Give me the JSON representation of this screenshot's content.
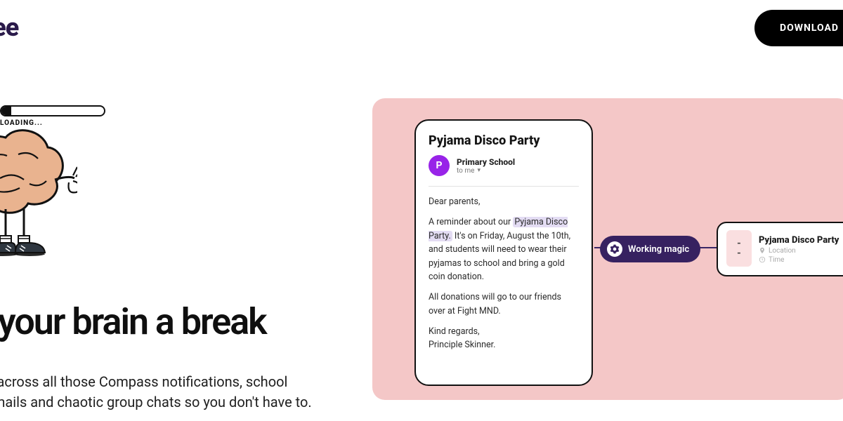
{
  "header": {
    "logo": "dee",
    "download": "DOWNLOAD"
  },
  "hero": {
    "loading_label": "LOADING...",
    "headline": "e your brain a break",
    "subtext_line1": "ays across all those Compass notifications, school",
    "subtext_line2": "s, emails and chaotic group chats so you don't have to."
  },
  "email": {
    "title": "Pyjama Disco Party",
    "avatar_letter": "P",
    "from_name": "Primary School",
    "to_line": "to me",
    "greeting": "Dear parents,",
    "body_pre": "A reminder about our ",
    "body_highlight": "Pyjama Disco Party.",
    "body_post": " It's on Friday, August the 10th, and students will need to wear their pyjamas to school and bring a gold coin donation.",
    "donation_line": "All donations will go to our friends over at Fight MND.",
    "signoff1": "Kind regards,",
    "signoff2": "Principle Skinner."
  },
  "magic_label": "Working magic",
  "event": {
    "thumb1": "-",
    "thumb2": "-",
    "title": "Pyjama Disco Party",
    "location": "Location",
    "time": "Time"
  }
}
